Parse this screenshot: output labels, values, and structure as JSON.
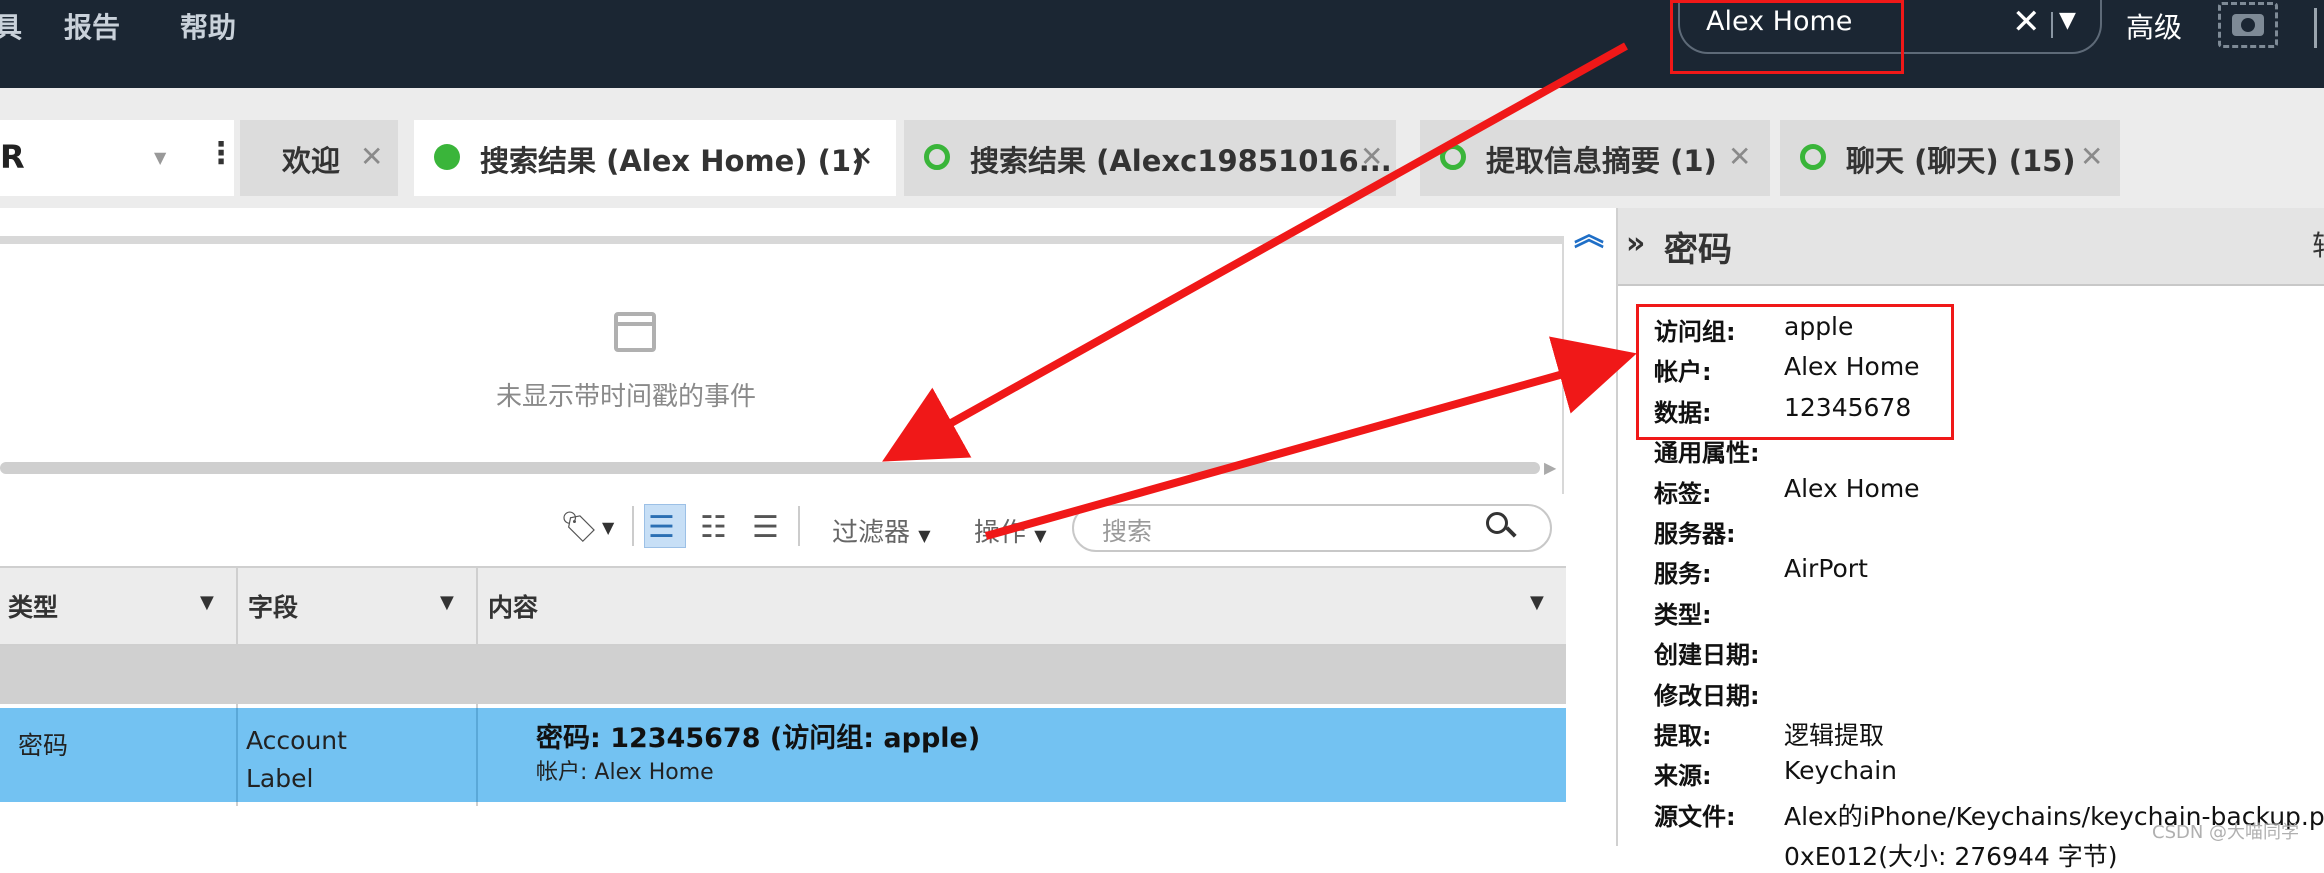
{
  "menu": {
    "item_partial": "具",
    "reports": "报告",
    "help": "帮助"
  },
  "search": {
    "value": "Alex Home",
    "clear": "✕",
    "dropdown": "▼"
  },
  "advanced_label": "高级",
  "control": {
    "partial_text": "R",
    "dropdown": "▼",
    "more": "⋮"
  },
  "tabs": [
    {
      "label": "欢迎",
      "close": "✕"
    },
    {
      "label": "搜索结果 (Alex Home) (1)",
      "close": "✕"
    },
    {
      "label": "搜索结果 (Alexc19851016...",
      "close": "✕"
    },
    {
      "label": "提取信息摘要 (1)",
      "close": "✕"
    },
    {
      "label": "聊天 (聊天) (15)",
      "close": "✕"
    }
  ],
  "timeline": {
    "empty_text": "未显示带时间戳的事件"
  },
  "toolbar": {
    "filter": "过滤器",
    "ops": "操作",
    "search_placeholder": "搜索",
    "dropdown": "▼"
  },
  "table": {
    "headers": [
      "类型",
      "字段",
      "内容"
    ],
    "row": {
      "type": "密码",
      "field_line1": "Account",
      "field_line2": "Label",
      "content_main": "密码: 12345678 (访问组: apple)",
      "content_sub": "帐户: Alex Home"
    }
  },
  "detail": {
    "title": "密码",
    "edge_partial": "轴",
    "fields": [
      {
        "k": "访问组:",
        "v": "apple"
      },
      {
        "k": "帐户:",
        "v": "Alex Home"
      },
      {
        "k": "数据:",
        "v": "12345678"
      },
      {
        "k": "通用属性:",
        "v": ""
      },
      {
        "k": "标签:",
        "v": "Alex Home"
      },
      {
        "k": "服务器:",
        "v": ""
      },
      {
        "k": "服务:",
        "v": "AirPort"
      },
      {
        "k": "类型:",
        "v": ""
      },
      {
        "k": "创建日期:",
        "v": ""
      },
      {
        "k": "修改日期:",
        "v": ""
      },
      {
        "k": "提取:",
        "v": "逻辑提取"
      },
      {
        "k": "来源:",
        "v": "Keychain"
      },
      {
        "k": "源文件:",
        "v": "Alex的iPhone/Keychains/keychain-backup.plist"
      },
      {
        "k": "",
        "v": "0xE012(大小: 276944 字节)"
      }
    ]
  },
  "watermark": "CSDN @大喵同学",
  "colors": {
    "topbar": "#1b2633",
    "selected_row": "#73c2f2",
    "status_green": "#3ab53a",
    "annotation_red": "#f01818"
  }
}
